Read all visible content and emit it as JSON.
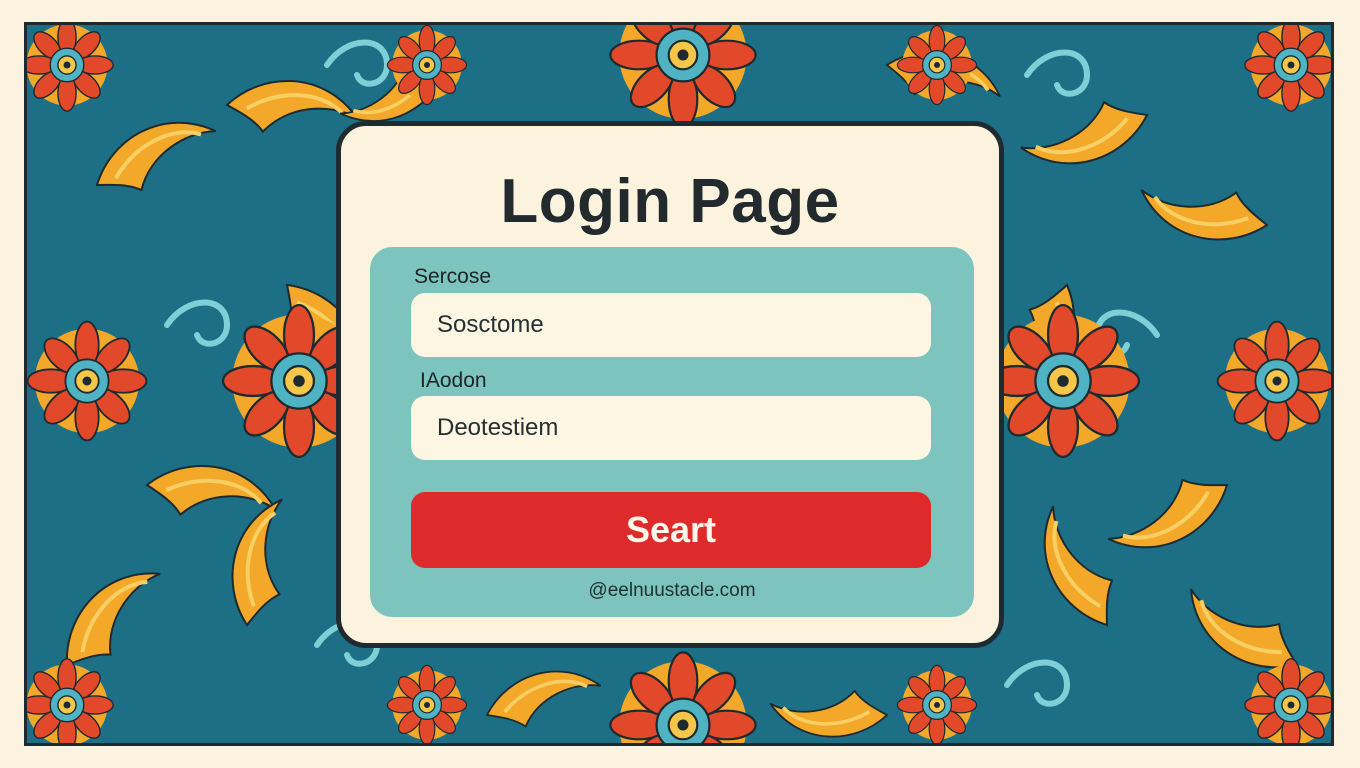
{
  "login": {
    "title": "Login Page",
    "field1_label": "Sercose",
    "field1_value": "Sosctome",
    "field2_label": "IAodon",
    "field2_value": "Deotestiem",
    "submit_label": "Seart",
    "footer_email": "@eelnuustacle.com"
  },
  "colors": {
    "page_bg": "#fbf3e0",
    "pattern_blue": "#1d6f86",
    "pattern_gold": "#f4a82a",
    "pattern_red": "#e2492b",
    "card_bg": "#fcf3df",
    "panel_teal": "#7cc4bd",
    "button_red": "#de2a2a",
    "text_dark": "#222a2d"
  }
}
